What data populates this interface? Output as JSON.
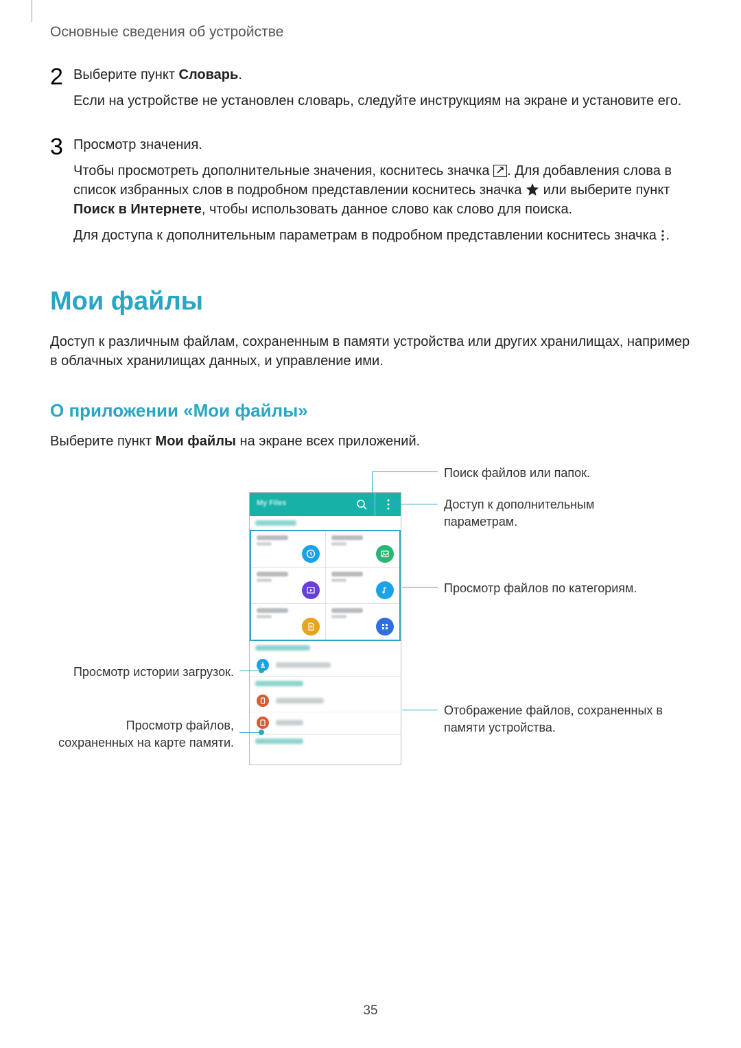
{
  "header": "Основные сведения об устройстве",
  "steps": [
    {
      "num": "2",
      "p1_pre": "Выберите пункт ",
      "p1_bold": "Словарь",
      "p1_post": ".",
      "p2": "Если на устройстве не установлен словарь, следуйте инструкциям на экране и установите его."
    },
    {
      "num": "3",
      "p1": "Просмотр значения.",
      "p2_a": "Чтобы просмотреть дополнительные значения, коснитесь значка ",
      "p2_b": ". Для добавления слова в список избранных слов в подробном представлении коснитесь значка ",
      "p2_c": " или выберите пункт ",
      "p2_bold": "Поиск в Интернете",
      "p2_d": ", чтобы использовать данное слово как слово для поиска.",
      "p3_a": "Для доступа к дополнительным параметрам в подробном представлении коснитесь значка ",
      "p3_b": "."
    }
  ],
  "h1": "Мои файлы",
  "intro": "Доступ к различным файлам, сохраненным в памяти устройства или других хранилищах, например в облачных хранилищах данных, и управление ими.",
  "h2": "О приложении «Мои файлы»",
  "body_pre": "Выберите пункт ",
  "body_bold": "Мои файлы",
  "body_post": " на экране всех приложений.",
  "callouts": {
    "search": "Поиск файлов или папок.",
    "more": "Доступ к дополнительным параметрам.",
    "categories": "Просмотр файлов по категориям.",
    "device": "Отображение файлов, сохраненных в памяти устройства.",
    "downloads": "Просмотр истории загрузок.",
    "sdcard": "Просмотр файлов, сохраненных на карте памяти."
  },
  "page_number": "35"
}
